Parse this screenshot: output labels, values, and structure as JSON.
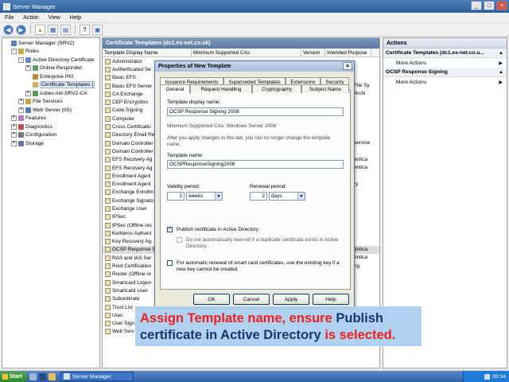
{
  "window": {
    "title": "Server Manager",
    "controls": [
      "_",
      "□",
      "×"
    ]
  },
  "menu": [
    "File",
    "Action",
    "View",
    "Help"
  ],
  "toolbar": {
    "buttons": [
      "back",
      "forward",
      "up",
      "show-hide",
      "export",
      "help",
      "console"
    ]
  },
  "tree": {
    "items": [
      {
        "label": "Server Manager (SRV2)",
        "indent": 0,
        "expander": "",
        "icon": "#5a7fb0"
      },
      {
        "label": "Roles",
        "indent": 1,
        "expander": "-",
        "icon": "#c9a640"
      },
      {
        "label": "Active Directory Certificate",
        "indent": 2,
        "expander": "-",
        "icon": "#6a8ab8"
      },
      {
        "label": "Online Responder:",
        "indent": 3,
        "expander": "+",
        "icon": "#6a9a6a"
      },
      {
        "label": "Enterprise PKI",
        "indent": 3,
        "expander": "",
        "icon": "#b88a40"
      },
      {
        "label": "Certificate Templates (",
        "indent": 3,
        "expander": "",
        "icon": "#c9b060",
        "selected": true
      },
      {
        "label": "subes-net-SRV2-CA",
        "indent": 3,
        "expander": "+",
        "icon": "#5a9a5a"
      },
      {
        "label": "File Services",
        "indent": 2,
        "expander": "+",
        "icon": "#c9a640"
      },
      {
        "label": "Web Server (IIS)",
        "indent": 2,
        "expander": "+",
        "icon": "#4a7ab8"
      },
      {
        "label": "Features",
        "indent": 1,
        "expander": "+",
        "icon": "#b07ac0"
      },
      {
        "label": "Diagnostics",
        "indent": 1,
        "expander": "+",
        "icon": "#c05050"
      },
      {
        "label": "Configuration",
        "indent": 1,
        "expander": "+",
        "icon": "#7a7a7a"
      },
      {
        "label": "Storage",
        "indent": 1,
        "expander": "+",
        "icon": "#6a7a9a"
      }
    ]
  },
  "center": {
    "header": "Certificate Templates (dc1.es-net.co.uk)",
    "columns": [
      "Template Display Name",
      "Minimum Supported CAs",
      "Version",
      "Intended Purpose"
    ],
    "rows": [
      "Administrator",
      "Authenticated Se",
      "Basic EFS",
      "Basic EFS Server",
      "CA Exchange",
      "CEP Encryption",
      "Code Signing",
      "Computer",
      "Cross Certificatio",
      "Directory Email Re",
      "Domain Controller",
      "Domain Controller",
      "EFS Recovery Ag",
      "EFS Recovery Ag",
      "Enrollment Agent",
      "Enrollment Agent",
      "Exchange Enrollm",
      "Exchange Signatu",
      "Exchange User",
      "IPSec",
      "IPSec (Offline rec",
      "Kerberos Authent",
      "Key Recovery Ag",
      "OCSP Response S",
      "RAS and IAS Ser",
      "Root Certification",
      "Router (Offline re",
      "Smartcard Logon",
      "Smartcard User",
      "Subordinate",
      "Trust List",
      "User",
      "User Sign",
      "Web Serv"
    ],
    "selected_row": 23,
    "right_fragments": [
      "File Sy",
      "Archi",
      "",
      "",
      "",
      "",
      "",
      "service",
      "",
      "entica",
      "entica",
      "",
      "ry",
      "",
      "",
      "",
      "",
      "",
      "",
      "",
      "entica",
      "entica",
      "ng"
    ]
  },
  "actions": {
    "header": "Actions",
    "sections": [
      {
        "title": "Certificate Templates (dc1.es-net.co.u...",
        "items": [
          "More Actions"
        ]
      },
      {
        "title": "OCSP Response Signing",
        "items": [
          "More Actions"
        ]
      }
    ]
  },
  "dialog": {
    "title": "Properties of New Template",
    "close": "×",
    "tabs_row1": [
      "Issuance Requirements",
      "Superseded Templates",
      "Extensions",
      "Security"
    ],
    "tabs_row2": [
      "General",
      "Request Handling",
      "Cryptography",
      "Subject Name"
    ],
    "active_tab": "General",
    "display_name_label": "Template display name:",
    "display_name_value": "OCSP Response Signing 2008",
    "min_ca": "Minimum Supported CAs:  Windows Server 2008",
    "info_text": "After you apply changes to this tab, you can no longer change the template name.",
    "template_name_label": "Template name:",
    "template_name_value": "OCSPResponseSigning2008",
    "validity_label": "Validity period:",
    "validity_value": "2",
    "validity_unit": "weeks",
    "renewal_label": "Renewal period:",
    "renewal_value": "2",
    "renewal_unit": "days",
    "publish_label": "Publish certificate in Active Directory",
    "publish_checked": true,
    "no_reenroll_label": "Do not automatically reenroll if a duplicate certificate exists in Active Directory",
    "smartcard_label": "For automatic renewal of smart card certificates, use the existing key if a new key cannot be created",
    "buttons": [
      "OK",
      "Cancel",
      "Apply",
      "Help"
    ]
  },
  "caption": {
    "part1": "Assign Template name, ensure ",
    "part2": "Publish certificate in Active Directory",
    "part3": " is selected."
  },
  "taskbar": {
    "start": "Start",
    "task": "Server Manager",
    "time": "09:34"
  }
}
